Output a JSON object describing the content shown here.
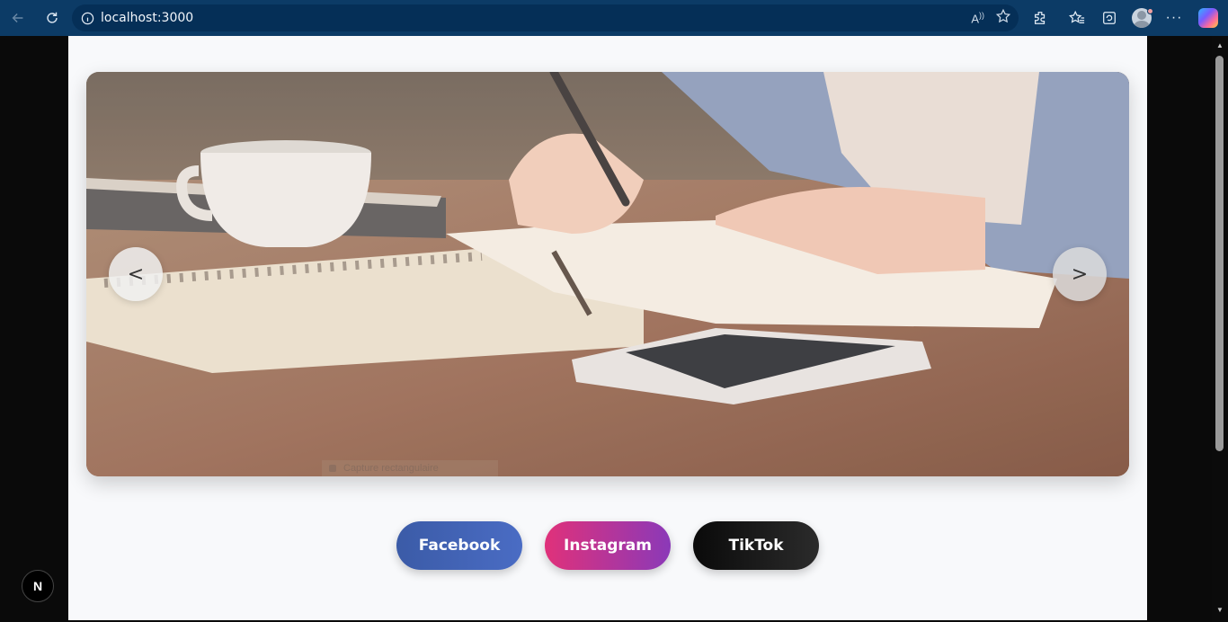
{
  "browser": {
    "url": "localhost:3000",
    "icons": [
      "back-icon",
      "refresh-icon",
      "info-icon",
      "read-aloud-icon",
      "favorite-star-icon",
      "extensions-icon",
      "favorites-icon",
      "collections-icon",
      "profile-icon",
      "more-icon",
      "copilot-icon"
    ]
  },
  "slider": {
    "prev_label": "<",
    "next_label": ">",
    "overlay_text": "Capture rectangulaire"
  },
  "social": {
    "facebook": "Facebook",
    "instagram": "Instagram",
    "tiktok": "TikTok"
  },
  "dev_badge": "N",
  "colors": {
    "chrome": "#0c3b66",
    "address_bar": "#052f57",
    "facebook": "#3b5ba7",
    "instagram_start": "#e0317a",
    "instagram_end": "#8b39b8",
    "tiktok": "#0a0a0a",
    "page_bg": "#f8f9fb"
  }
}
